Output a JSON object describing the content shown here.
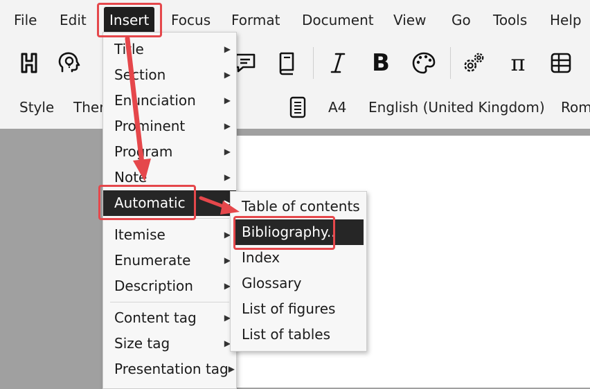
{
  "menubar": {
    "items": [
      "File",
      "Edit",
      "Insert",
      "Focus",
      "Format",
      "Document",
      "View",
      "Go",
      "Tools",
      "Help"
    ],
    "active": "Insert"
  },
  "toolbar": {
    "icons": [
      "heading-icon",
      "idea-icon",
      "comment-icon",
      "book-icon",
      "italic-icon",
      "bold-icon",
      "palette-icon",
      "gears-icon",
      "pi-icon",
      "table-icon"
    ],
    "bold_label": "B",
    "pi_label": "π"
  },
  "formatbar": {
    "style_label": "Style",
    "theme_label": "Ther",
    "page_size": "A4",
    "language": "English (United Kingdom)",
    "font": "Rom"
  },
  "insert_menu": {
    "items": [
      {
        "label": "Title",
        "submenu": true
      },
      {
        "label": "Section",
        "submenu": true
      },
      {
        "label": "Enunciation",
        "submenu": true
      },
      {
        "label": "Prominent",
        "submenu": true
      },
      {
        "label": "Program",
        "submenu": true
      },
      {
        "label": "Note",
        "submenu": true
      },
      {
        "label": "Automatic",
        "submenu": true,
        "highlighted": true
      },
      {
        "label": "Itemise",
        "submenu": true
      },
      {
        "label": "Enumerate",
        "submenu": true
      },
      {
        "label": "Description",
        "submenu": true
      },
      {
        "label": "Content tag",
        "submenu": true
      },
      {
        "label": "Size tag",
        "submenu": true
      },
      {
        "label": "Presentation tag",
        "submenu": true
      }
    ]
  },
  "automatic_submenu": {
    "items": [
      {
        "label": "Table of contents"
      },
      {
        "label": "Bibliography..",
        "highlighted": true
      },
      {
        "label": "Index"
      },
      {
        "label": "Glossary"
      },
      {
        "label": "List of figures"
      },
      {
        "label": "List of tables"
      }
    ]
  },
  "colors": {
    "annotation": "#e5474b",
    "highlight": "#262626",
    "toolbar_bg": "#f3f3f3",
    "canvas_bg": "#a0a0a0"
  }
}
